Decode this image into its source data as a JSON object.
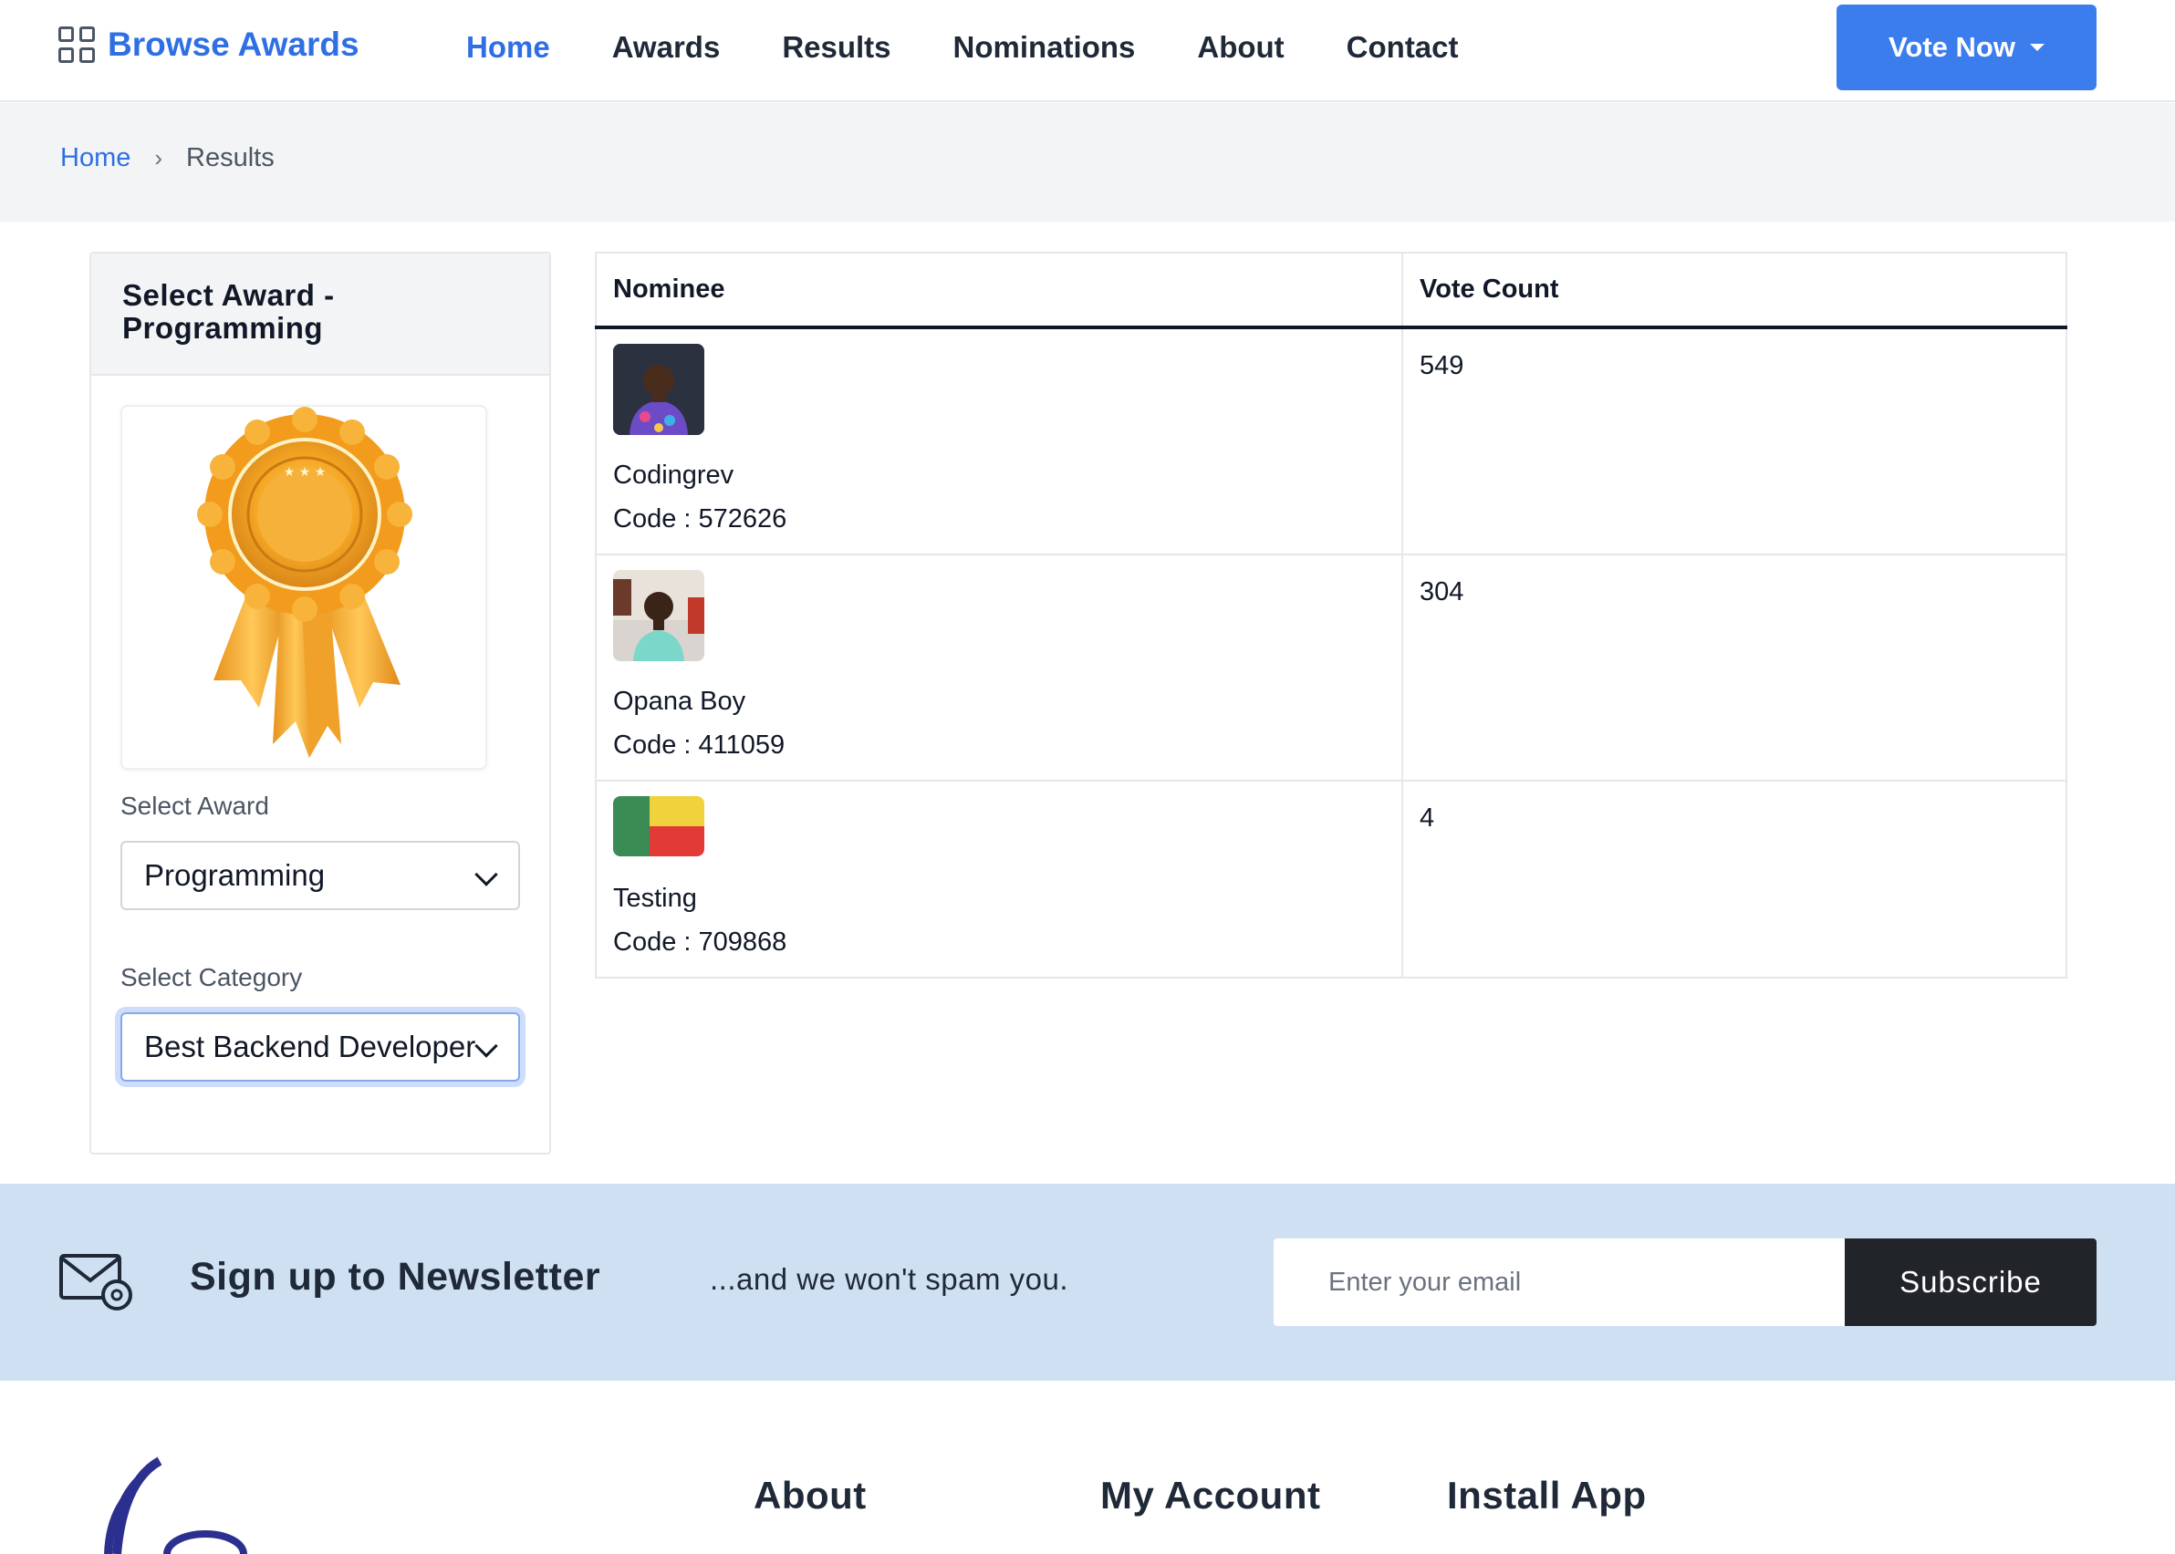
{
  "brand": {
    "name": "Browse Awards",
    "icon": "grid-icon",
    "color": "#2f6fe4"
  },
  "nav": {
    "items": [
      {
        "label": "Home",
        "active": true
      },
      {
        "label": "Awards"
      },
      {
        "label": "Results"
      },
      {
        "label": "Nominations"
      },
      {
        "label": "About"
      },
      {
        "label": "Contact"
      }
    ],
    "vote_button": "Vote Now"
  },
  "breadcrumb": {
    "home": "Home",
    "separator": "›",
    "current": "Results"
  },
  "sidebar": {
    "title": "Select Award - Programming",
    "award_image": "award-rosette-icon",
    "award_label": "Select Award",
    "award_value": "Programming",
    "category_label": "Select Category",
    "category_value": "Best Backend Developer"
  },
  "results_table": {
    "headers": [
      "Nominee",
      "Vote Count"
    ],
    "rows": [
      {
        "name": "Codingrev",
        "code": "Code : 572626",
        "votes": "549",
        "image": "nominee-photo"
      },
      {
        "name": "Opana Boy",
        "code": "Code : 411059",
        "votes": "304",
        "image": "nominee-photo"
      },
      {
        "name": "Testing",
        "code": "Code : 709868",
        "votes": "4",
        "image": "benin-flag"
      }
    ]
  },
  "newsletter": {
    "title": "Sign up to Newsletter",
    "subtitle": "...and we won't spam you.",
    "email_placeholder": "Enter your email",
    "button": "Subscribe",
    "icon": "envelope-at-icon"
  },
  "footer": {
    "headings": [
      "About",
      "My Account",
      "Install App"
    ]
  },
  "colors": {
    "accent": "#3b7ded",
    "newsletter_bg": "#cfe0f3",
    "dark": "#212529"
  }
}
